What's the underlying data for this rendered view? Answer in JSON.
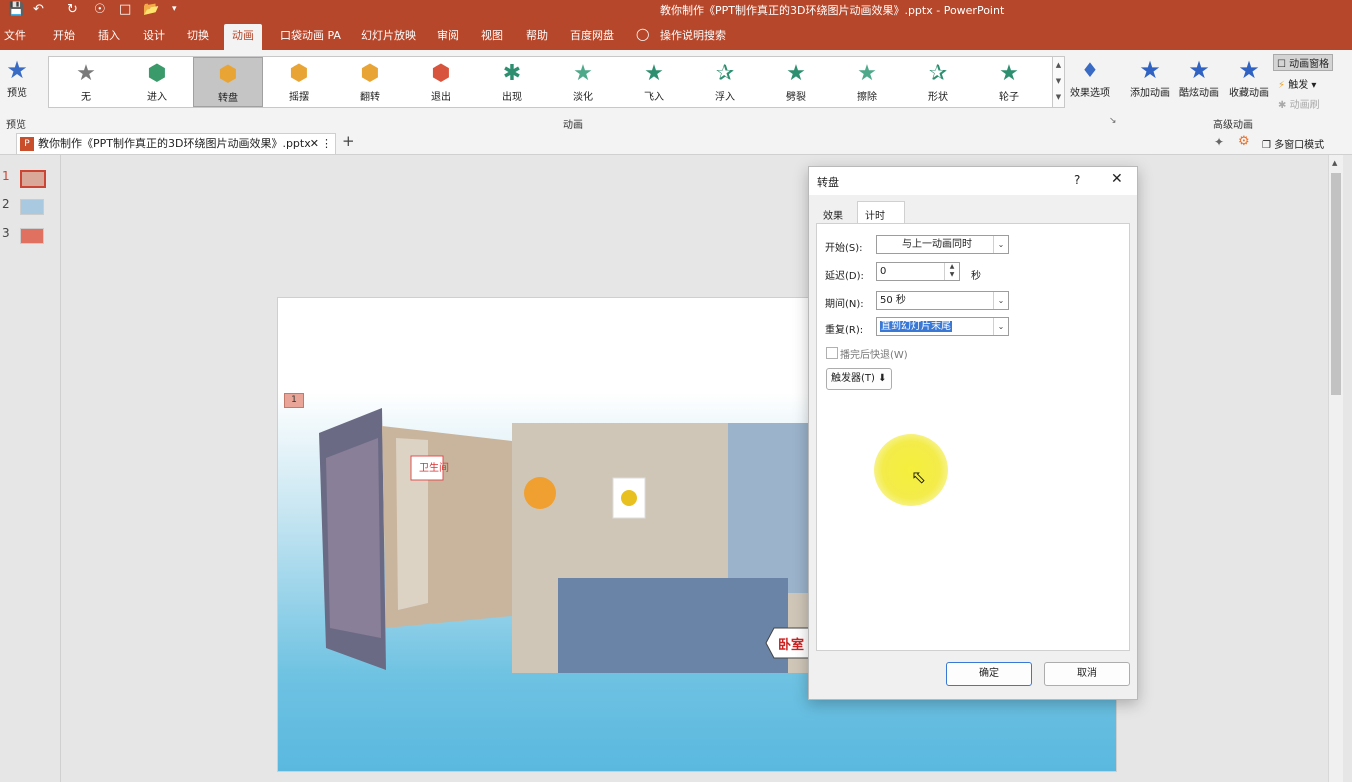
{
  "titlebar": {
    "title": "教你制作《PPT制作真正的3D环绕图片动画效果》.pptx  -  PowerPoint",
    "icons": [
      "save-icon",
      "undo-icon",
      "redo-icon",
      "touch-mode-icon",
      "new-file-icon",
      "open-file-icon",
      "customize-icon"
    ]
  },
  "menu": {
    "tabs": [
      "文件",
      "开始",
      "插入",
      "设计",
      "切换",
      "动画",
      "口袋动画 PA",
      "幻灯片放映",
      "审阅",
      "视图",
      "帮助",
      "百度网盘"
    ],
    "active": "动画",
    "search": "操作说明搜索"
  },
  "ribbon": {
    "preview_label": "预览",
    "preview_group": "预览",
    "animation_group": "动画",
    "advanced_group": "高级动画",
    "gallery": [
      {
        "label": "无",
        "color": "#7a7a7a"
      },
      {
        "label": "进入",
        "color": "#3a9a6a"
      },
      {
        "label": "转盘",
        "color": "#e8a535"
      },
      {
        "label": "摇摆",
        "color": "#e8a535"
      },
      {
        "label": "翻转",
        "color": "#e8a535"
      },
      {
        "label": "退出",
        "color": "#d9543d"
      },
      {
        "label": "出现",
        "color": "#2e8f70"
      },
      {
        "label": "淡化",
        "color": "#4ea88a"
      },
      {
        "label": "飞入",
        "color": "#2e8f70"
      },
      {
        "label": "浮入",
        "color": "#2e8f70"
      },
      {
        "label": "劈裂",
        "color": "#2e8f70"
      },
      {
        "label": "擦除",
        "color": "#4ea88a"
      },
      {
        "label": "形状",
        "color": "#2e8f70"
      },
      {
        "label": "轮子",
        "color": "#2e8f70"
      }
    ],
    "effect_options": "效果选项",
    "add_animation": "添加动画",
    "cool_animation": "酷炫动画",
    "fav_animation": "收藏动画",
    "anim_pane": "动画窗格",
    "trigger": "触发",
    "anim_painter": "动画刷"
  },
  "docrow": {
    "tab_title": "教你制作《PPT制作真正的3D环绕图片动画效果》.pptx",
    "multi_window": "多窗口模式"
  },
  "thumbs": [
    "1",
    "2",
    "3"
  ],
  "slide": {
    "anim_tag": "1",
    "sign_left": "卫生间",
    "sign_right": "卧室"
  },
  "dialog": {
    "title": "转盘",
    "help": "?",
    "tabs": [
      "效果",
      "计时"
    ],
    "active_tab": "计时",
    "start_label": "开始(S):",
    "start_value": "与上一动画同时",
    "delay_label": "延迟(D):",
    "delay_value": "0",
    "delay_unit": "秒",
    "duration_label": "期间(N):",
    "duration_value": "50 秒",
    "repeat_label": "重复(R):",
    "repeat_value": "直到幻灯片末尾",
    "rewind_label": "播完后快退(W)",
    "trigger_label": "触发器(T)",
    "ok": "确定",
    "cancel": "取消"
  }
}
